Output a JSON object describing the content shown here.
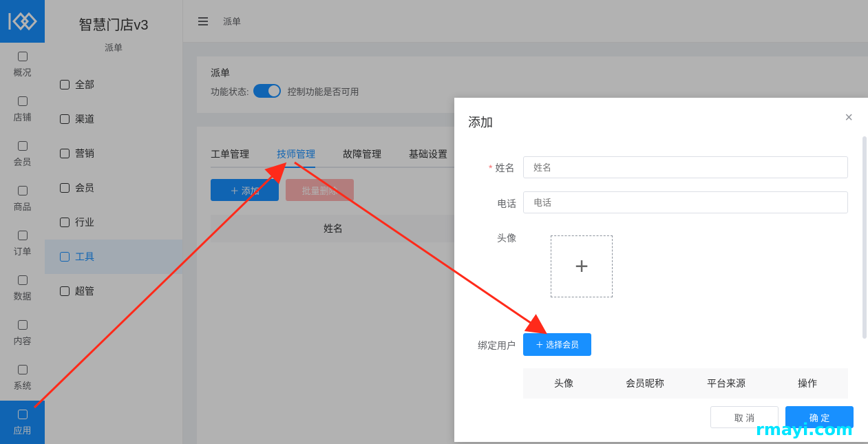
{
  "rail": {
    "items": [
      {
        "label": "概况"
      },
      {
        "label": "店铺"
      },
      {
        "label": "会员"
      },
      {
        "label": "商品"
      },
      {
        "label": "订单"
      },
      {
        "label": "数据"
      },
      {
        "label": "内容"
      },
      {
        "label": "系统"
      },
      {
        "label": "应用"
      }
    ],
    "active": "应用"
  },
  "sub": {
    "store_name": "智慧门店v3",
    "section": "派单",
    "items": [
      {
        "label": "全部"
      },
      {
        "label": "渠道"
      },
      {
        "label": "营销"
      },
      {
        "label": "会员"
      },
      {
        "label": "行业"
      },
      {
        "label": "工具"
      },
      {
        "label": "超管"
      }
    ],
    "active": "工具"
  },
  "header": {
    "breadcrumb": "派单"
  },
  "feature": {
    "title": "派单",
    "status_label": "功能状态:",
    "status_desc": "控制功能是否可用",
    "enabled": true
  },
  "tabs": [
    {
      "label": "工单管理"
    },
    {
      "label": "技师管理"
    },
    {
      "label": "故障管理"
    },
    {
      "label": "基础设置"
    }
  ],
  "active_tab": "技师管理",
  "toolbar": {
    "add": "＋ 添加",
    "batch_delete": "批量删除"
  },
  "table": {
    "header_name": "姓名"
  },
  "dialog": {
    "title": "添加",
    "close_icon": "×",
    "name_label": "姓名",
    "name_placeholder": "姓名",
    "phone_label": "电话",
    "phone_placeholder": "电话",
    "avatar_label": "头像",
    "bind_label": "绑定用户",
    "select_member": "＋ 选择会员",
    "columns": [
      "头像",
      "会员昵称",
      "平台来源",
      "操作"
    ],
    "cancel": "取 消",
    "confirm": "确 定"
  },
  "watermark": "rmayi.com",
  "colors": {
    "primary": "#1890ff",
    "arrow": "#ff2a1a",
    "danger": "#f56c6c"
  }
}
